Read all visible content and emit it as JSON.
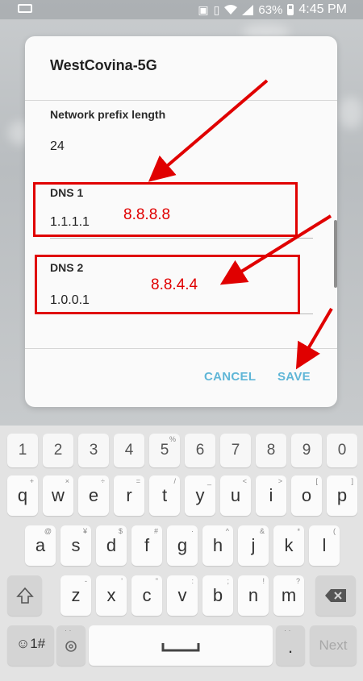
{
  "statusbar": {
    "battery": "63%",
    "time": "4:45 PM",
    "icons": [
      "keyboard-icon",
      "nfc-icon",
      "vibrate-icon",
      "wifi-icon",
      "signal-icon",
      "battery-icon"
    ]
  },
  "dialog": {
    "title": "WestCovina-5G",
    "prefix_label": "Network prefix length",
    "prefix_value": "24",
    "dns1_label": "DNS 1",
    "dns1_value": "1.1.1.1",
    "dns2_label": "DNS 2",
    "dns2_value": "1.0.0.1",
    "cancel_label": "CANCEL",
    "save_label": "SAVE"
  },
  "annotations": {
    "dns1_note": "8.8.8.8",
    "dns2_note": "8.8.4.4",
    "color": "#e00000"
  },
  "keyboard": {
    "number_row": [
      "1",
      "2",
      "3",
      "4",
      "5",
      "6",
      "7",
      "8",
      "9",
      "0"
    ],
    "row1": [
      {
        "key": "q",
        "hint": "+"
      },
      {
        "key": "w",
        "hint": "×"
      },
      {
        "key": "e",
        "hint": "÷"
      },
      {
        "key": "r",
        "hint": "="
      },
      {
        "key": "t",
        "hint": "/"
      },
      {
        "key": "y",
        "hint": "_"
      },
      {
        "key": "u",
        "hint": "<"
      },
      {
        "key": "i",
        "hint": ">"
      },
      {
        "key": "o",
        "hint": "["
      },
      {
        "key": "p",
        "hint": "]"
      }
    ],
    "row2": [
      {
        "key": "a",
        "hint": "@"
      },
      {
        "key": "s",
        "hint": "¥"
      },
      {
        "key": "d",
        "hint": "$"
      },
      {
        "key": "f",
        "hint": "#"
      },
      {
        "key": "g",
        "hint": "·"
      },
      {
        "key": "h",
        "hint": "^"
      },
      {
        "key": "j",
        "hint": "&"
      },
      {
        "key": "k",
        "hint": "*"
      },
      {
        "key": "l",
        "hint": "("
      }
    ],
    "row3": [
      {
        "key": "z",
        "hint": "-"
      },
      {
        "key": "x",
        "hint": "'"
      },
      {
        "key": "c",
        "hint": "\""
      },
      {
        "key": "v",
        "hint": ":"
      },
      {
        "key": "b",
        "hint": ";"
      },
      {
        "key": "n",
        "hint": "!"
      },
      {
        "key": "m",
        "hint": "?"
      }
    ],
    "sym_label": "☺1#",
    "period_label": ".",
    "next_label": "Next",
    "number_row_hint_1": "%"
  }
}
